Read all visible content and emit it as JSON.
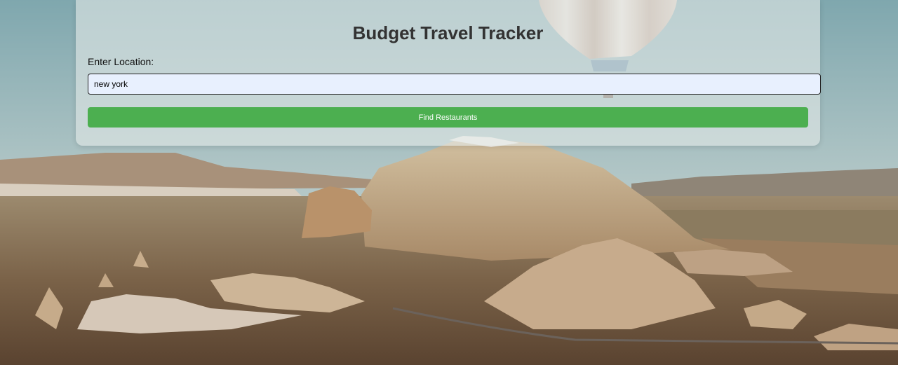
{
  "page": {
    "title": "Budget Travel Tracker"
  },
  "form": {
    "location_label": "Enter Location:",
    "location_value": "new york",
    "location_placeholder": "",
    "submit_label": "Find Restaurants"
  },
  "colors": {
    "button_bg": "#4caf50",
    "button_text": "#ffffff",
    "input_bg": "#e8f0fe",
    "title_text": "#333333"
  },
  "background": {
    "icon": "cappadocia-landscape-with-hot-air-balloon"
  }
}
